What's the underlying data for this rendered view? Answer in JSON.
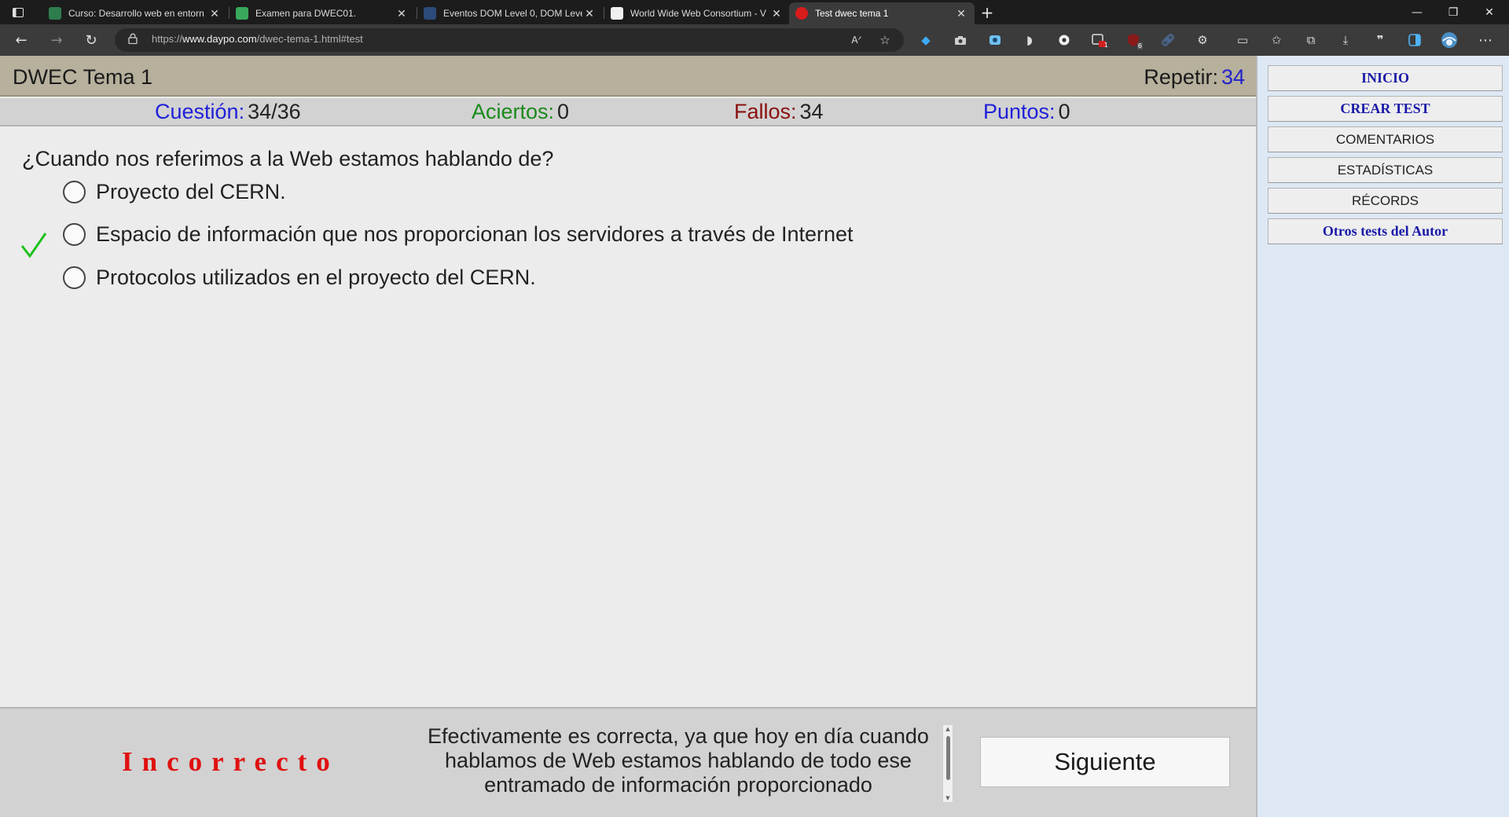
{
  "browser": {
    "tabs": [
      {
        "title": "Curso: Desarrollo web en entorn",
        "active": false,
        "favicon_color": "#2e7d4f"
      },
      {
        "title": "Examen para DWEC01.",
        "active": false,
        "favicon_color": "#3aa85c"
      },
      {
        "title": "Eventos DOM Level 0, DOM Leve",
        "active": false,
        "favicon_color": "#2c4a7a"
      },
      {
        "title": "World Wide Web Consortium - V",
        "active": false,
        "favicon_color": "#f0f0f0"
      },
      {
        "title": "Test dwec tema 1",
        "active": true,
        "favicon_color": "#d81b1b"
      }
    ],
    "address": {
      "prefix": "https://",
      "domain": "www.daypo.com",
      "path": "/dwec-tema-1.html#test"
    },
    "toolbar_icons": [
      "read-aloud-icon",
      "add-favorite-icon",
      "extension-gem-icon",
      "screenshot-icon",
      "capture-icon",
      "extension-dark-icon",
      "record-icon",
      "extension-badge-icon",
      "ublock-icon",
      "link-icon",
      "extensions-icon",
      "split-screen-icon",
      "favorites-icon",
      "collections-icon",
      "downloads-icon",
      "quotes-icon",
      "edge-bar-icon",
      "profile-avatar-icon",
      "more-menu-icon"
    ],
    "extension_badges": {
      "one": "1",
      "two": "6"
    }
  },
  "test": {
    "title": "DWEC Tema 1",
    "repeat_label": "Repetir:",
    "repeat_value": "34",
    "scores": [
      {
        "label": "Cuestión:",
        "value": "34/36",
        "color": "#2020d8"
      },
      {
        "label": "Aciertos:",
        "value": "0",
        "color": "#1a8a1a"
      },
      {
        "label": "Fallos:",
        "value": "34",
        "color": "#8a1010"
      },
      {
        "label": "Puntos:",
        "value": "0",
        "color": "#2020d8"
      }
    ],
    "question": "¿Cuando nos referimos a la Web estamos hablando de?",
    "options": [
      {
        "label": "Proyecto del CERN.",
        "correct": false
      },
      {
        "label": "Espacio de información que nos proporcionan los servidores a través de Internet",
        "correct": true
      },
      {
        "label": "Protocolos utilizados en el proyecto del CERN.",
        "correct": false
      }
    ],
    "result": "Incorrecto",
    "explanation": "Efectivamente es correcta, ya que hoy en día cuando hablamos de Web estamos hablando de todo ese entramado de información proporcionado",
    "next_label": "Siguiente"
  },
  "menu": [
    {
      "label": "INICIO",
      "style": "bold"
    },
    {
      "label": "CREAR TEST",
      "style": "bold"
    },
    {
      "label": "COMENTARIOS",
      "style": "normal"
    },
    {
      "label": "ESTADÍSTICAS",
      "style": "normal"
    },
    {
      "label": "RÉCORDS",
      "style": "normal"
    },
    {
      "label": "Otros tests del Autor",
      "style": "bold"
    }
  ]
}
